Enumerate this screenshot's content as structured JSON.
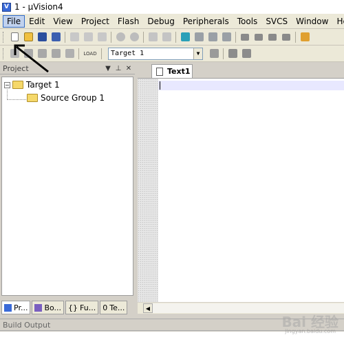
{
  "window": {
    "title": "1  - µVision4"
  },
  "menu": [
    {
      "label": "File"
    },
    {
      "label": "Edit"
    },
    {
      "label": "View"
    },
    {
      "label": "Project"
    },
    {
      "label": "Flash"
    },
    {
      "label": "Debug"
    },
    {
      "label": "Peripherals"
    },
    {
      "label": "Tools"
    },
    {
      "label": "SVCS"
    },
    {
      "label": "Window"
    },
    {
      "label": "Help"
    }
  ],
  "toolbar2": {
    "target_value": "Target 1",
    "load_label": "LOAD"
  },
  "project_panel": {
    "title": "Project",
    "tree": {
      "root": "Target 1",
      "group": "Source Group 1"
    },
    "tabs": [
      {
        "label": "Pr..."
      },
      {
        "label": "Bo..."
      },
      {
        "label": "Fu..."
      },
      {
        "label": "Te..."
      }
    ]
  },
  "editor": {
    "tab_label": "Text1"
  },
  "build_output": {
    "title": "Build Output"
  },
  "watermark": {
    "main": "Bai 经验",
    "sub": "jingyan.baidu.com"
  },
  "colors": {
    "menu_bg": "#ece9d8",
    "active_menu": "#c1d2ee",
    "frame": "#d4d0c8"
  }
}
